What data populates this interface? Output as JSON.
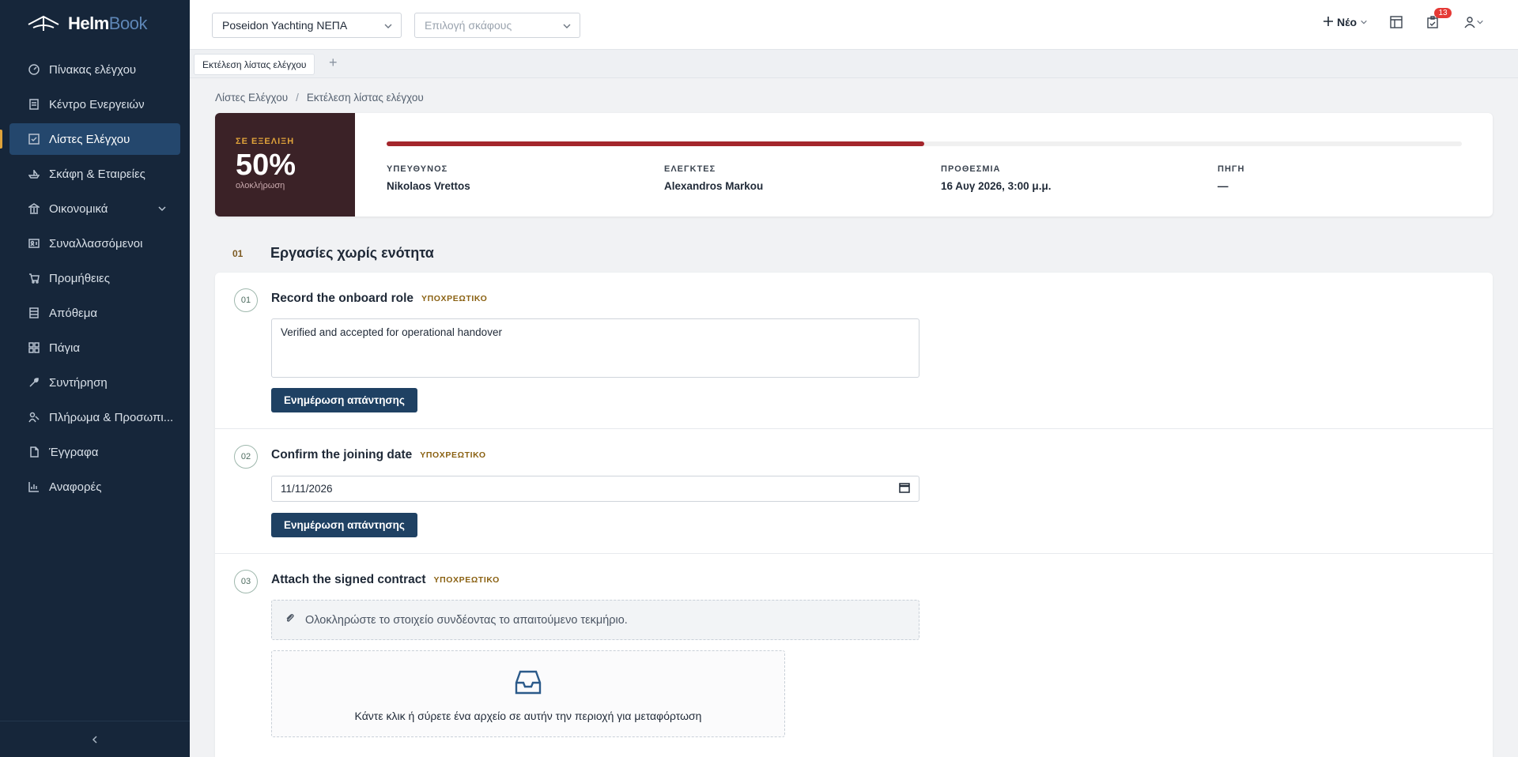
{
  "app": {
    "logo_main": "Helm",
    "logo_accent": "Book"
  },
  "sidebar": {
    "items": [
      {
        "label": "Πίνακας ελέγχου",
        "icon": "gauge-icon"
      },
      {
        "label": "Κέντρο Ενεργειών",
        "icon": "checklist-icon"
      },
      {
        "label": "Λίστες Ελέγχου",
        "icon": "check-square-icon",
        "active": true
      },
      {
        "label": "Σκάφη & Εταιρείες",
        "icon": "ship-icon"
      },
      {
        "label": "Οικονομικά",
        "icon": "bank-icon",
        "expandable": true
      },
      {
        "label": "Συναλλασσόμενοι",
        "icon": "contacts-icon"
      },
      {
        "label": "Προμήθειες",
        "icon": "cart-icon"
      },
      {
        "label": "Απόθεμα",
        "icon": "inventory-icon"
      },
      {
        "label": "Πάγια",
        "icon": "grid-icon"
      },
      {
        "label": "Συντήρηση",
        "icon": "wrench-icon"
      },
      {
        "label": "Πλήρωμα & Προσωπι...",
        "icon": "crew-icon"
      },
      {
        "label": "Έγγραφα",
        "icon": "document-icon"
      },
      {
        "label": "Αναφορές",
        "icon": "bar-chart-icon"
      }
    ]
  },
  "header": {
    "company_select": "Poseidon Yachting ΝΕΠΑ",
    "vessel_placeholder": "Επιλογή σκάφους",
    "new_label": "Νέο",
    "notification_count": "13"
  },
  "tabs": {
    "active_label": "Εκτέλεση λίστας ελέγχου",
    "add_label": "+"
  },
  "breadcrumb": {
    "parent": "Λίστες Ελέγχου",
    "sep": "/",
    "current": "Εκτέλεση λίστας ελέγχου"
  },
  "progress": {
    "status": "ΣΕ ΕΞΕΛΙΞΗ",
    "percent_text": "50%",
    "percent_value": 50,
    "percent_sub": "ολοκλήρωση",
    "bar_color": "#a4262c",
    "owner_label": "ΥΠΕΥΘΥΝΟΣ",
    "owner_value": "Nikolaos Vrettos",
    "inspectors_label": "ΕΛΕΓΚΤΕΣ",
    "inspectors_value": "Alexandros Markou",
    "deadline_label": "ΠΡΟΘΕΣΜΙΑ",
    "deadline_value": "16 Αυγ 2026, 3:00 μ.μ.",
    "source_label": "ΠΗΓΗ",
    "source_value": "—"
  },
  "section": {
    "number": "01",
    "title": "Εργασίες χωρίς ενότητα"
  },
  "tasks": [
    {
      "number": "01",
      "title": "Record the onboard role",
      "required": "ΥΠΟΧΡΕΩΤΙΚΟ",
      "answer": "Verified and accepted for operational handover",
      "button": "Ενημέρωση απάντησης"
    },
    {
      "number": "02",
      "title": "Confirm the joining date",
      "required": "ΥΠΟΧΡΕΩΤΙΚΟ",
      "date": "11/11/2026",
      "button": "Ενημέρωση απάντησης"
    },
    {
      "number": "03",
      "title": "Attach the signed contract",
      "required": "ΥΠΟΧΡΕΩΤΙΚΟ",
      "notice": "Ολοκληρώστε το στοιχείο συνδέοντας το απαιτούμενο τεκμήριο.",
      "dropzone": "Κάντε κλικ ή σύρετε ένα αρχείο σε αυτήν την περιοχή για μεταφόρτωση"
    }
  ]
}
